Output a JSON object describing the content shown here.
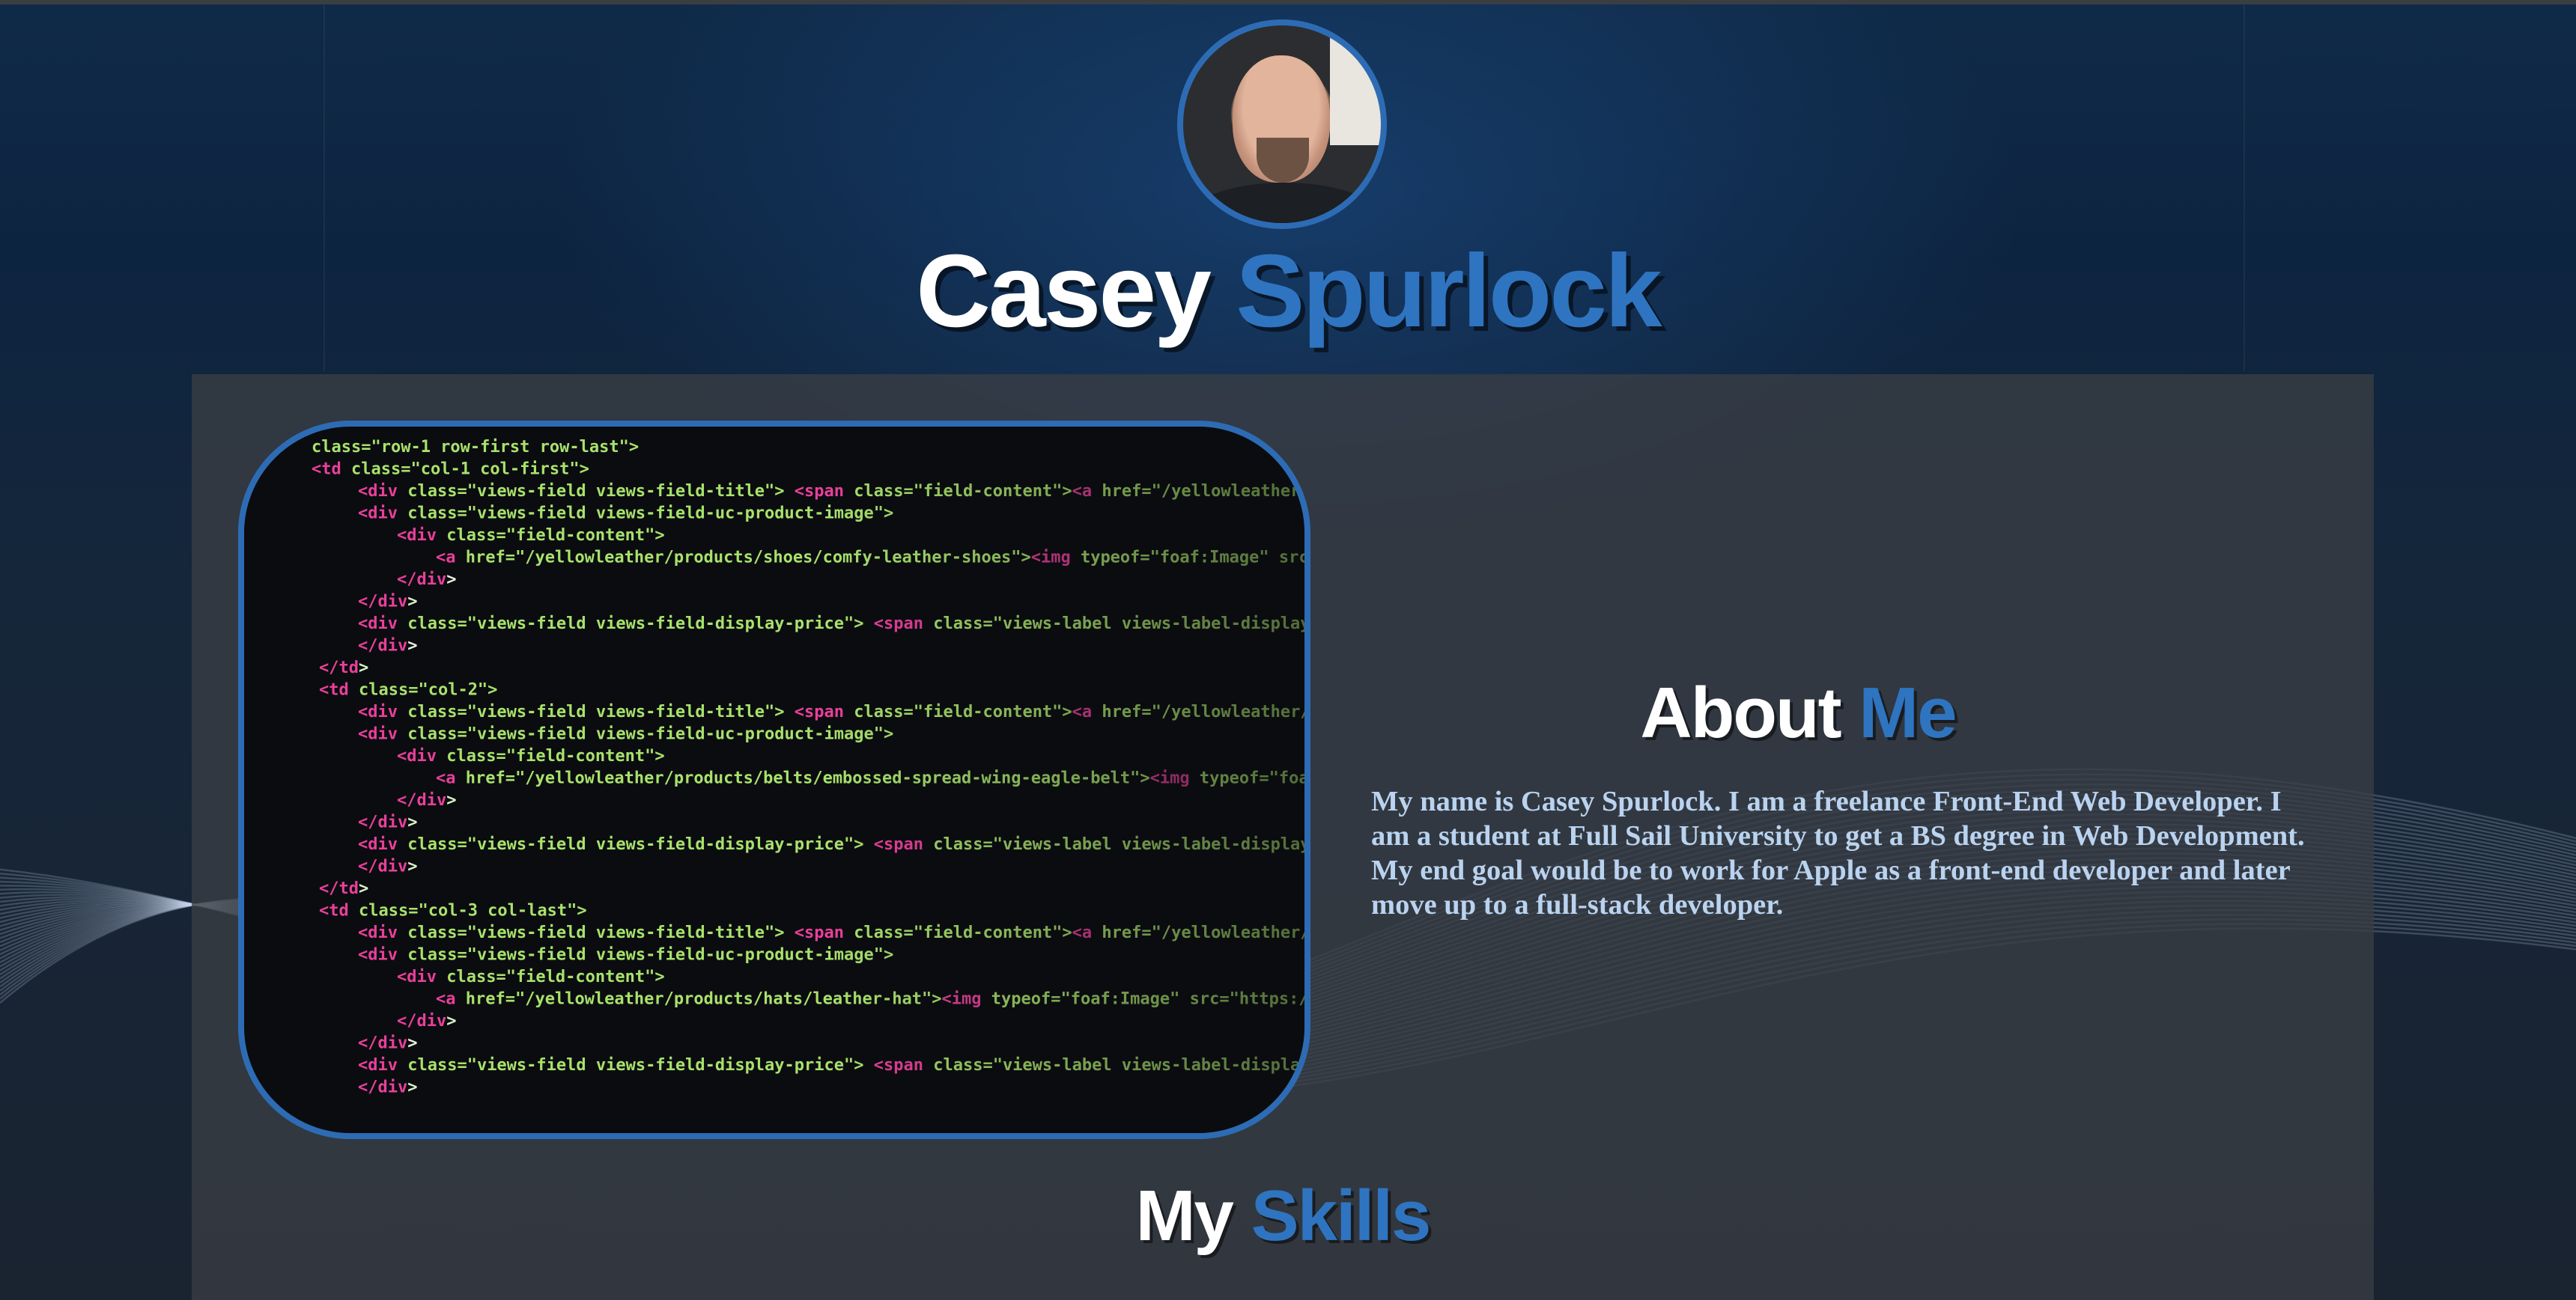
{
  "header": {
    "name_first": "Casey",
    "name_last": "Spurlock",
    "avatar_alt": "profile photo"
  },
  "about": {
    "heading_first": "About",
    "heading_last": "Me",
    "body": "My name is Casey Spurlock. I am a freelance Front-End Web Developer. I am a student at Full Sail University to get a BS degree in Web Development. My end goal would be to work for Apple as a front-end developer and later move up to a full-stack developer."
  },
  "skills": {
    "heading_first": "My",
    "heading_last": "Skills"
  },
  "code_image": {
    "lines": [
      "class=\"row-1 row-first row-last\">",
      "<td class=\"col-1 col-first\">",
      "<div class=\"views-field views-field-title\"> <span class=\"field-content\"><a href=\"/yellowleather/products/sh",
      "<div class=\"views-field views-field-uc-product-image\">",
      "<div class=\"field-content\">",
      "<a href=\"/yellowleather/products/shoes/comfy-leather-shoes\"><img typeof=\"foaf:Image\" src=\"https://ref",
      "</div>",
      "</div>",
      "<div class=\"views-field views-field-display-price\"> <span class=\"views-label views-label-display-price",
      "</div>",
      "</td>",
      "<td class=\"col-2\">",
      "<div class=\"views-field views-field-title\"> <span class=\"field-content\"><a href=\"/yellowleather/products/be",
      "<div class=\"views-field views-field-uc-product-image\">",
      "<div class=\"field-content\">",
      "<a href=\"/yellowleather/products/belts/embossed-spread-wing-eagle-belt\"><img typeof=\"foaf:Image\" src",
      "</div>",
      "</div>",
      "<div class=\"views-field views-field-display-price\"> <span class=\"views-label views-label-display-price",
      "</div>",
      "</td>",
      "<td class=\"col-3 col-last\">",
      "<div class=\"views-field views-field-title\"> <span class=\"field-content\"><a href=\"/yellowleather/products/ha",
      "<div class=\"views-field views-field-uc-product-image\">",
      "<div class=\"field-content\">",
      "<a href=\"/yellowleather/products/hats/leather-hat\"><img typeof=\"foaf:Image\" src=\"https://yellowleathe",
      "</div>",
      "</div>",
      "<div class=\"views-field views-field-display-price\"> <span class=\"views-label views-label-display-price",
      "</div>"
    ]
  },
  "colors": {
    "accent": "#2f74c0",
    "heading": "#ffffff",
    "body_text": "#b9d3f0",
    "panel": "#3a3e44",
    "background": "#0f2a48"
  }
}
